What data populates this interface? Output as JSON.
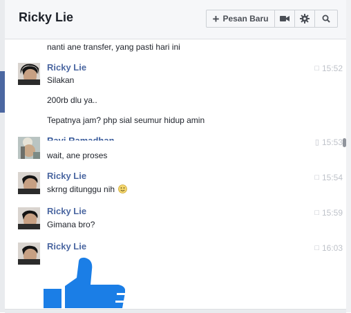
{
  "header": {
    "title": "Ricky Lie",
    "new_message_label": "Pesan Baru",
    "new_message_icon": "plus-icon",
    "video_icon": "video-camera-icon",
    "settings_icon": "gear-icon",
    "search_icon": "search-icon"
  },
  "messages": [
    {
      "text": "nanti ane transfer, yang pasti hari ini"
    },
    {
      "sender": "Ricky Lie",
      "time": "15:52",
      "lines": [
        "Silakan",
        "200rb dlu ya..",
        "Tepatnya jam? php sial seumur hidup amin"
      ]
    },
    {
      "sender": "Ravi Ramadhan",
      "time": "15:53",
      "lines": [
        "wait, ane proses"
      ]
    },
    {
      "sender": "Ricky Lie",
      "time": "15:54",
      "lines": [
        "skrng ditunggu nih"
      ]
    },
    {
      "sender": "Ricky Lie",
      "time": "15:59",
      "lines": [
        "Gimana bro?"
      ]
    },
    {
      "sender": "Ricky Lie",
      "time": "16:03"
    }
  ],
  "big_like_icon": "thumbs-up-icon",
  "colors": {
    "name": "#4b67a1",
    "like": "#1b7ee6",
    "time": "#bec2c9"
  }
}
